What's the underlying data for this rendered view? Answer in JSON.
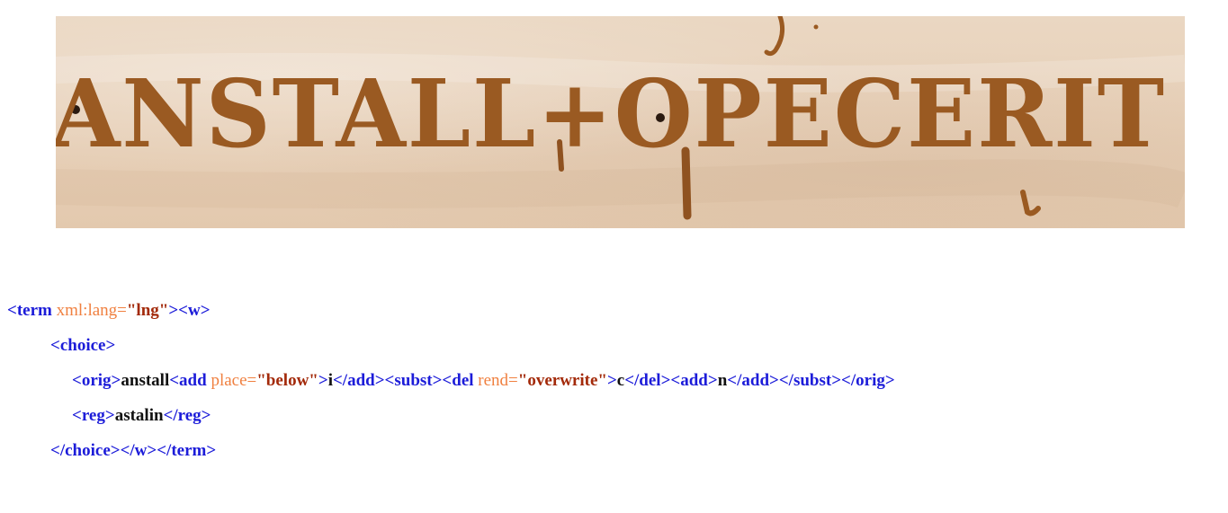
{
  "manuscript": {
    "ink_text": "ANSTALL+OPECERIT",
    "colors": {
      "parchment": "#e8d2bb",
      "ink": "#9a5a22"
    }
  },
  "code": {
    "line1": {
      "t1": "<term ",
      "a1": "xml:lang=",
      "v1": "\"lng\"",
      "t2": "><w>"
    },
    "line2": {
      "t1": "<choice>"
    },
    "line3": {
      "t1": "<orig>",
      "x1": "anstall",
      "t2": "<add ",
      "a1": "place=",
      "v1": "\"below\"",
      "t3": ">",
      "x2": "i",
      "t4": "</add><subst><del ",
      "a2": "rend=",
      "v2": "\"overwrite\"",
      "t5": ">",
      "x3": "c",
      "t6": "</del><add>",
      "x4": "n",
      "t7": "</add></subst></orig>"
    },
    "line4": {
      "t1": "<reg>",
      "x1": "astalin",
      "t2": "</reg>"
    },
    "line5": {
      "t1": "</choice></w></term>"
    },
    "colors": {
      "tag": "#1c1cd9",
      "attr": "#f08040",
      "value": "#a32a0a",
      "text": "#111111"
    }
  }
}
